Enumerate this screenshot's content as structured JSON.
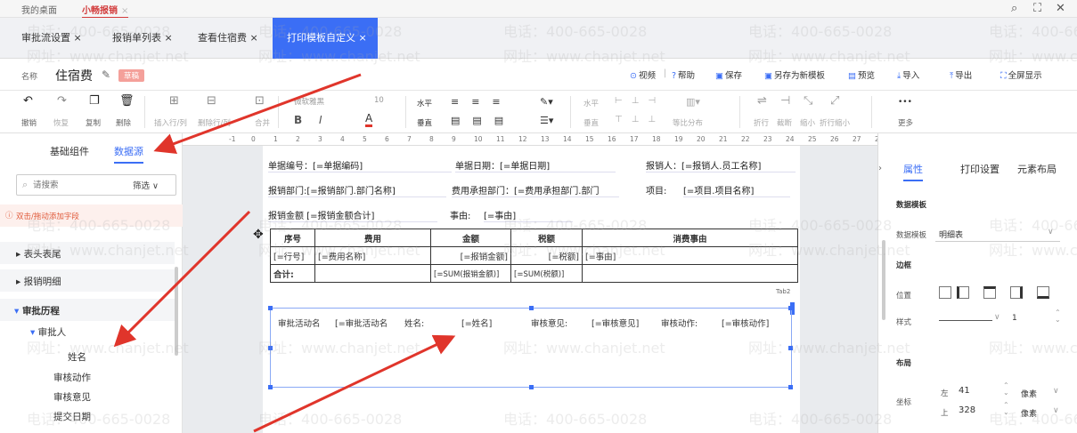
{
  "top": {
    "tab_desktop": "我的桌面",
    "tab_app": "小畅报销",
    "close": "×"
  },
  "tabs": [
    {
      "label": "审批流设置 ×"
    },
    {
      "label": "报销单列表 ×"
    },
    {
      "label": "查看住宿费 ×"
    },
    {
      "label": "打印模板自定义 ×"
    }
  ],
  "title": {
    "name_label": "名称",
    "name_value": "住宿费",
    "edit_icon": "✎",
    "badge": "草稿"
  },
  "actions": [
    "视频",
    "帮助",
    "保存",
    "另存为新模板",
    "预览",
    "导入",
    "导出",
    "全屏显示"
  ],
  "toolbar": {
    "undo": "撤销",
    "redo": "恢复",
    "copy": "复制",
    "delete": "删除",
    "insert_row": "插入行/列",
    "delete_row": "删除行/列",
    "merge": "合并",
    "font_family": "微软雅黑",
    "font_size": "10",
    "bold": "B",
    "italic": "I",
    "color": "A",
    "h_align": "水平",
    "v_align": "垂直",
    "ph_align": "水平",
    "pv_align": "垂直",
    "dist": "等比分布",
    "wrap": "折行",
    "cut": "截断",
    "shrink": "缩小",
    "shrink_wrap": "折行缩小",
    "more_ellipsis": "•••",
    "more": "更多"
  },
  "left_panel": {
    "tab_basic": "基础组件",
    "tab_data": "数据源",
    "search_placeholder": "请搜索",
    "filter": "筛选",
    "hint": "双击/拖动添加字段",
    "tree": [
      "表头表尾",
      "报销明细",
      "审批历程",
      "审批人",
      "姓名",
      "审核动作",
      "审核意见",
      "提交日期"
    ]
  },
  "ruler": [
    "-1",
    "0",
    "1",
    "2",
    "3",
    "4",
    "5",
    "6",
    "7",
    "8",
    "9",
    "10",
    "11",
    "12",
    "13",
    "14",
    "15",
    "16",
    "17",
    "18",
    "19",
    "20",
    "21",
    "22",
    "23",
    "24",
    "25",
    "26",
    "27",
    "28",
    "29"
  ],
  "form": {
    "doc_no": "单据编号：[=单据编码]",
    "doc_date": "单据日期：[=单据日期]",
    "reporter": "报销人：[=报销人.员工名称]",
    "dept": "报销部门:[=报销部门.部门名称]",
    "cost_dept": "费用承担部门：[=费用承担部门.部门",
    "project_label": "项目:",
    "project_value": "[=项目.项目名称]",
    "amount": "报销金额 [=报销金额合计]",
    "reason_label": "事由:",
    "reason_value": "[=事由]"
  },
  "table": {
    "headers": [
      "序号",
      "费用",
      "金额",
      "税额",
      "消费事由"
    ],
    "row": [
      "[=行号]",
      "[=费用名称]",
      "[=报销金额]",
      "[=税额]",
      "[=事由]"
    ],
    "total_label": "合计:",
    "total_amount": "[=SUM(报销金额)]",
    "total_tax": "[=SUM(税额)]",
    "tab_label": "Tab2"
  },
  "approval": {
    "activity_label": "审批活动名",
    "activity_value": "[=审批活动名",
    "name_label": "姓名:",
    "name_value": "[=姓名]",
    "opinion_label": "审核意见:",
    "opinion_value": "[=审核意见]",
    "action_label": "审核动作:",
    "action_value": "[=审核动作]"
  },
  "right_panel": {
    "tab_props": "属性",
    "tab_print": "打印设置",
    "tab_layout": "元素布局",
    "data_model": "数据模板",
    "data_model_label": "数据模板",
    "data_model_value": "明细表",
    "border": "边框",
    "position": "位置",
    "style": "样式",
    "style_value": "1",
    "layout": "布局",
    "coord": "坐标",
    "left_label": "左",
    "left_value": "41",
    "top_label": "上",
    "top_value": "328",
    "unit": "像素"
  },
  "watermark": {
    "phone": "电话：400-665-0028",
    "site": "网址：www.chanjet.net"
  },
  "colors": {
    "accent": "#3b6ef5",
    "arrow": "#e0352b",
    "badge": "#f4a09a"
  }
}
